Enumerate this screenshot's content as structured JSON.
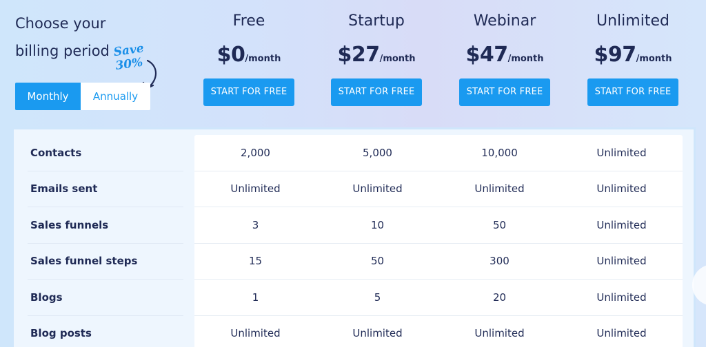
{
  "billing": {
    "title_line1": "Choose your",
    "title_line2": "billing period",
    "save_note_line1": "Save",
    "save_note_line2": "30%",
    "toggle": {
      "monthly": "Monthly",
      "annually": "Annually",
      "selected": "Monthly"
    }
  },
  "plans": [
    {
      "name": "Free",
      "amount": "$0",
      "period": "/month",
      "button": "START FOR FREE"
    },
    {
      "name": "Startup",
      "amount": "$27",
      "period": "/month",
      "button": "START FOR FREE"
    },
    {
      "name": "Webinar",
      "amount": "$47",
      "period": "/month",
      "button": "START FOR FREE"
    },
    {
      "name": "Unlimited",
      "amount": "$97",
      "period": "/month",
      "button": "START FOR FREE"
    }
  ],
  "features": [
    {
      "label": "Contacts",
      "values": [
        "2,000",
        "5,000",
        "10,000",
        "Unlimited"
      ]
    },
    {
      "label": "Emails sent",
      "values": [
        "Unlimited",
        "Unlimited",
        "Unlimited",
        "Unlimited"
      ]
    },
    {
      "label": "Sales funnels",
      "values": [
        "3",
        "10",
        "50",
        "Unlimited"
      ]
    },
    {
      "label": "Sales funnel steps",
      "values": [
        "15",
        "50",
        "300",
        "Unlimited"
      ]
    },
    {
      "label": "Blogs",
      "values": [
        "1",
        "5",
        "20",
        "Unlimited"
      ]
    },
    {
      "label": "Blog posts",
      "values": [
        "Unlimited",
        "Unlimited",
        "Unlimited",
        "Unlimited"
      ]
    }
  ],
  "colors": {
    "accent": "#1a9af0",
    "text": "#1f2a55",
    "save_note": "#1a8fe8"
  }
}
